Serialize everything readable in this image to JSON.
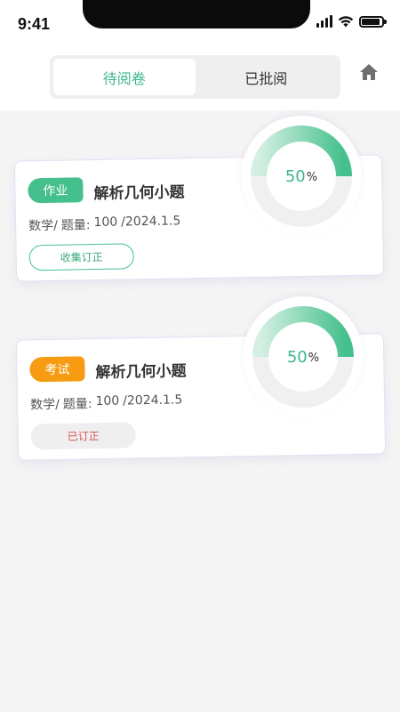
{
  "status_bar": {
    "time": "9:41"
  },
  "tabs": [
    {
      "label": "待阅卷",
      "active": true
    },
    {
      "label": "已批阅",
      "active": false
    }
  ],
  "header": {
    "home_icon": "home-icon"
  },
  "colors": {
    "accent_green": "#3cb88b",
    "badge_green": "#45c08c",
    "badge_orange": "#f79c12",
    "status_red": "#d9534f"
  },
  "cards": [
    {
      "badge": "作业",
      "badge_color": "green",
      "title": "解析几何小题",
      "subject": "数学/",
      "count_label": "题量:",
      "count": "100",
      "date": "/2024.1.5",
      "button_label": "收集订正",
      "progress_value": "50",
      "progress_unit": "%",
      "progress_fraction": 0.5
    },
    {
      "badge": "考试",
      "badge_color": "orange",
      "title": "解析几何小题",
      "subject": "数学/",
      "count_label": "题量:",
      "count": "100",
      "date": "/2024.1.5",
      "button_label": "已订正",
      "progress_value": "50",
      "progress_unit": "%",
      "progress_fraction": 0.5
    }
  ]
}
